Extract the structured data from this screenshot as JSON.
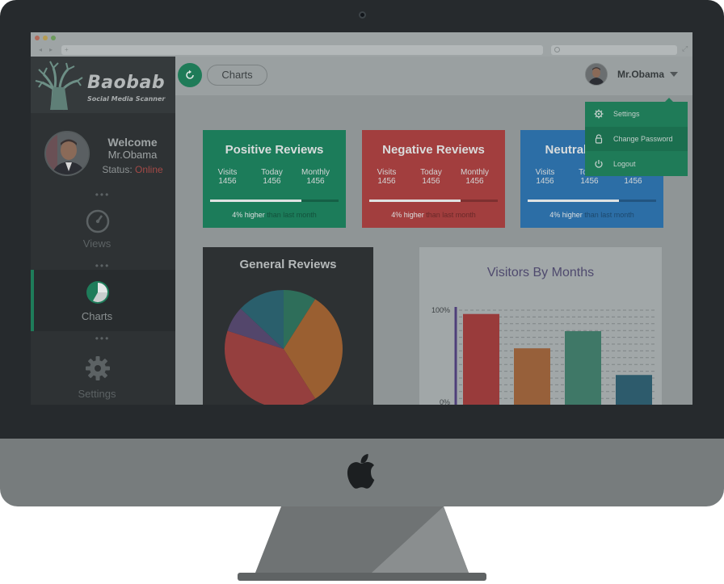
{
  "brand": {
    "name": "Baobab",
    "tagline": "Social Media Scanner"
  },
  "browser": {
    "url_placeholder": "+"
  },
  "sidebar": {
    "welcome": "Welcome",
    "user": "Mr.Obama",
    "status_label": "Status: ",
    "status_value": "Online",
    "items": [
      {
        "label": "Views",
        "icon": "gauge-icon"
      },
      {
        "label": "Charts",
        "icon": "pie-chart-icon",
        "active": true
      },
      {
        "label": "Settings",
        "icon": "gear-icon"
      }
    ]
  },
  "topbar": {
    "breadcrumb": "Charts",
    "user_name": "Mr.Obama"
  },
  "dropdown": {
    "items": [
      {
        "label": "Settings",
        "icon": "gear-icon"
      },
      {
        "label": "Change Password",
        "icon": "lock-icon"
      },
      {
        "label": "Logout",
        "icon": "power-icon"
      }
    ]
  },
  "cards": [
    {
      "title": "Positive Reviews",
      "color": "#1c7c5a",
      "visits_label": "Visits",
      "visits": "1456",
      "today_label": "Today",
      "today": "1456",
      "monthly_label": "Monthly",
      "monthly": "1456",
      "progress": 0.71,
      "note_highlight": "4% higher",
      "note_rest": " than last month"
    },
    {
      "title": "Negative Reviews",
      "color": "#a23e3e",
      "visits_label": "Visits",
      "visits": "1456",
      "today_label": "Today",
      "today": "1456",
      "monthly_label": "Monthly",
      "monthly": "1456",
      "progress": 0.71,
      "note_highlight": "4% higher",
      "note_rest": " than last month"
    },
    {
      "title": "Neutral Reviews",
      "color": "#2c6ea6",
      "visits_label": "Visits",
      "visits": "1456",
      "today_label": "Today",
      "today": "1456",
      "monthly_label": "Monthly",
      "monthly": "1456",
      "progress": 0.71,
      "note_highlight": "4% higher",
      "note_rest": " than last month"
    }
  ],
  "charts": {
    "pie": {
      "title": "General Reviews"
    },
    "bar": {
      "title": "Visitors By Months"
    }
  },
  "chart_data": [
    {
      "type": "pie",
      "title": "General Reviews",
      "slices": [
        {
          "value": 9,
          "color": "#2e6e5a"
        },
        {
          "value": 32,
          "color": "#9a5f31"
        },
        {
          "value": 39,
          "color": "#953f3e"
        },
        {
          "value": 7,
          "color": "#53466b"
        },
        {
          "value": 13,
          "color": "#2a5f6c"
        }
      ]
    },
    {
      "type": "bar",
      "title": "Visitors By Months",
      "ytick_labels": [
        "100%",
        "0%"
      ],
      "ylim": [
        0,
        100
      ],
      "values": [
        96,
        60,
        78,
        32
      ],
      "colors": [
        "#993b3b",
        "#97603a",
        "#3f7867",
        "#2d5b6c"
      ]
    }
  ]
}
